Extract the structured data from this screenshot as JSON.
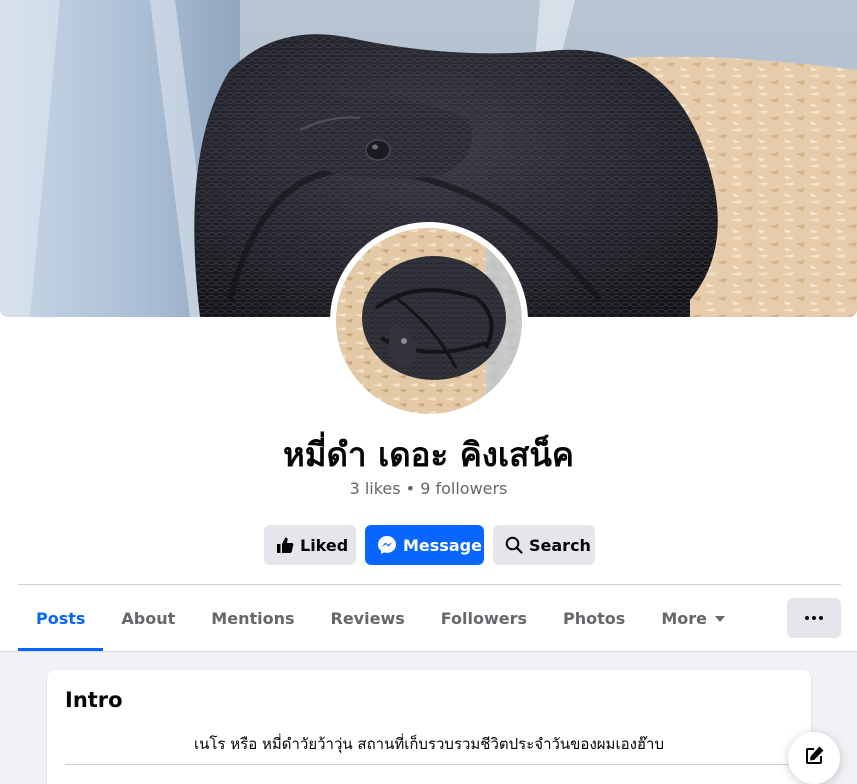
{
  "profile": {
    "name": "หมี่ดำ เดอะ คิงเสน็ค",
    "stats": "3 likes • 9 followers",
    "cover_image": "black snake in terrarium with wood shavings",
    "avatar_image": "coiled black snake on wood shavings"
  },
  "actions": {
    "liked_label": "Liked",
    "message_label": "Message",
    "search_label": "Search"
  },
  "tabs": [
    {
      "label": "Posts",
      "active": true
    },
    {
      "label": "About"
    },
    {
      "label": "Mentions"
    },
    {
      "label": "Reviews"
    },
    {
      "label": "Followers"
    },
    {
      "label": "Photos"
    },
    {
      "label": "More"
    }
  ],
  "intro": {
    "title": "Intro",
    "bio": "เนโร หรือ หมี่ดำวัยว้าวุ่น สถานที่เก็บรวบรวมชีวิตประจำวันของผมเองฮ๊าบ"
  },
  "icons": {
    "like": "thumbs-up-icon",
    "message": "messenger-icon",
    "search": "search-icon",
    "more": "ellipsis-icon",
    "compose": "compose-icon"
  },
  "colors": {
    "accent": "#0866ff",
    "button_gray": "#e4e6eb",
    "text_secondary": "#65676b"
  }
}
